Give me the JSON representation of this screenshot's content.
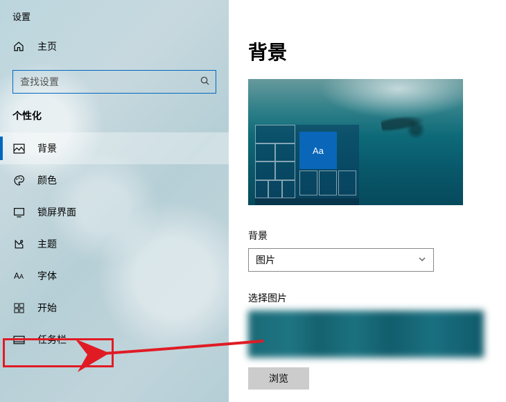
{
  "app_title": "设置",
  "home_label": "主页",
  "search_placeholder": "查找设置",
  "section_header": "个性化",
  "nav": [
    {
      "key": "background",
      "label": "背景",
      "icon": "picture-icon",
      "selected": true
    },
    {
      "key": "colors",
      "label": "颜色",
      "icon": "palette-icon",
      "selected": false
    },
    {
      "key": "lockscreen",
      "label": "锁屏界面",
      "icon": "lockscreen-icon",
      "selected": false
    },
    {
      "key": "themes",
      "label": "主题",
      "icon": "theme-icon",
      "selected": false
    },
    {
      "key": "fonts",
      "label": "字体",
      "icon": "font-icon",
      "selected": false
    },
    {
      "key": "start",
      "label": "开始",
      "icon": "start-icon",
      "selected": false
    },
    {
      "key": "taskbar",
      "label": "任务栏",
      "icon": "taskbar-icon",
      "selected": false
    }
  ],
  "page": {
    "title": "背景",
    "preview_sample_text": "Aa",
    "bg_label": "背景",
    "bg_selected": "图片",
    "choose_label": "选择图片",
    "browse_label": "浏览"
  },
  "annotation": {
    "highlight_nav_key": "taskbar"
  }
}
